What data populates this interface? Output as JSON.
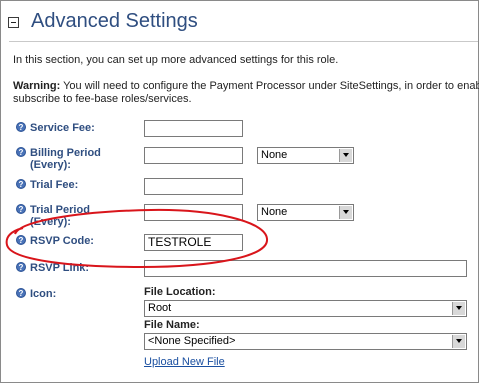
{
  "header": {
    "title": "Advanced Settings"
  },
  "intro_text": "In this section, you can set up more advanced settings for this role.",
  "warning": {
    "label": "Warning:",
    "line1": " You will need to configure the Payment Processor under SiteSettings, in order to enab",
    "line2": "subscribe to fee-base roles/services."
  },
  "fields": {
    "service_fee": {
      "label": "Service Fee:",
      "value": ""
    },
    "billing_period": {
      "label_line1": "Billing Period",
      "label_line2": "(Every):",
      "value": "",
      "unit_selected": "None"
    },
    "trial_fee": {
      "label": "Trial Fee:",
      "value": ""
    },
    "trial_period": {
      "label_line1": "Trial Period",
      "label_line2": "(Every):",
      "value": "",
      "unit_selected": "None"
    },
    "rsvp_code": {
      "label": "RSVP Code:",
      "value": "TESTROLE"
    },
    "rsvp_link": {
      "label": "RSVP Link:",
      "value": ""
    },
    "icon": {
      "label": "Icon:",
      "file_location_label": "File Location:",
      "file_location_selected": "Root",
      "file_name_label": "File Name:",
      "file_name_selected": "<None Specified>",
      "upload_link": "Upload New File"
    }
  },
  "colors": {
    "label": "#2f4e80",
    "highlight": "#d9151b"
  },
  "icons": {
    "help": "question-circle-icon",
    "collapse": "minus-box-icon"
  }
}
